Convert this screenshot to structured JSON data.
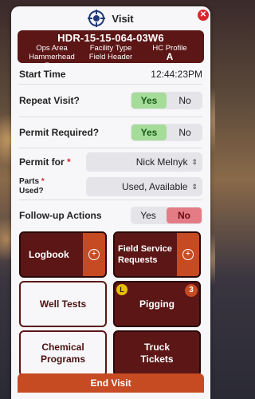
{
  "header": {
    "title": "Visit",
    "logo_icon": "crosshair-logo-icon",
    "close_icon": "close-icon"
  },
  "site": {
    "id": "HDR-15-15-064-03W6",
    "ops_area_label": "Ops Area",
    "ops_area_value": "Hammerhead Run",
    "facility_type_label": "Facility Type",
    "facility_type_value": "Field Header",
    "hc_profile_label": "HC Profile",
    "hc_profile_value": "A"
  },
  "form": {
    "start_time_label": "Start Time",
    "start_time_value": "12:44:23PM",
    "repeat_visit_label": "Repeat Visit?",
    "repeat_visit_selected": "Yes",
    "permit_required_label": "Permit Required?",
    "permit_required_selected": "Yes",
    "permit_for_label": "Permit for",
    "permit_for_value": "Nick Melnyk",
    "parts_used_label_1": "Parts",
    "parts_used_label_2": "Used?",
    "parts_used_value": "Used, Available",
    "followup_label": "Follow-up Actions",
    "followup_selected": "No",
    "yes": "Yes",
    "no": "No",
    "required_mark": "*"
  },
  "tiles": {
    "logbook": "Logbook",
    "field_service_1": "Field Service",
    "field_service_2": "Requests",
    "well_tests": "Well Tests",
    "pigging": "Pigging",
    "pigging_badge_letter": "L",
    "pigging_count": "3",
    "chemical_1": "Chemical",
    "chemical_2": "Programs",
    "truck_1": "Truck",
    "truck_2": "Tickets",
    "plus": "+"
  },
  "end_visit": "End Visit",
  "colors": {
    "brand_dark": "#5c1616",
    "accent_orange": "#c64a22",
    "yes_green": "#a6dc9a",
    "no_red": "#e47c86",
    "close_red": "#d9262c"
  }
}
